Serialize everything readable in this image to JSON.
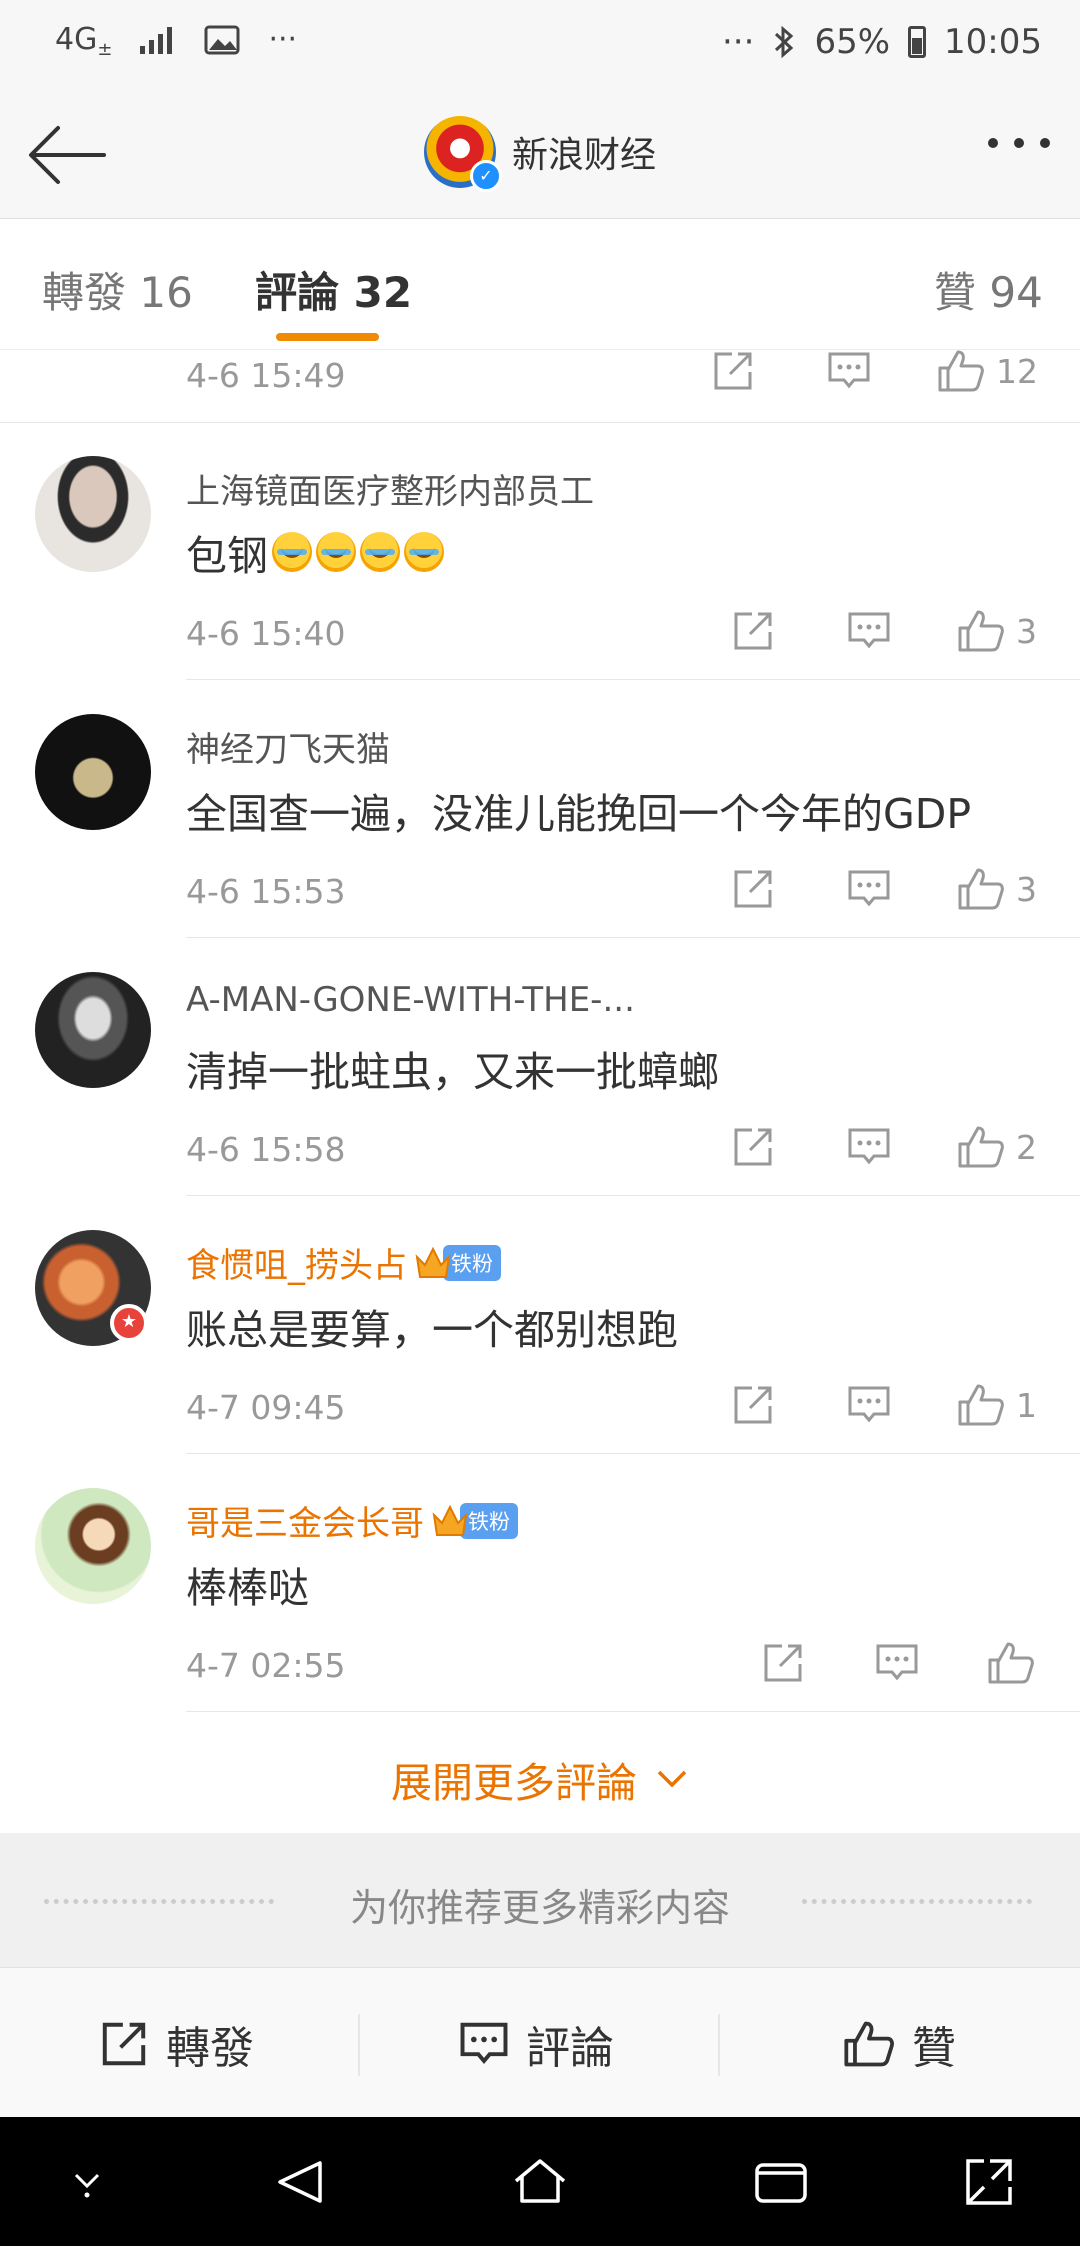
{
  "status_bar": {
    "network": "4G",
    "network_sub": "±",
    "overflow": "···",
    "right_overflow": "···",
    "battery": "65%",
    "time": "10:05"
  },
  "header": {
    "title": "新浪财经"
  },
  "tabs": [
    {
      "label": "轉發 16"
    },
    {
      "label": "評論 32"
    },
    {
      "label": "贊 94"
    }
  ],
  "partial_comment": {
    "time": "4-6 15:49",
    "likes": "12"
  },
  "comments": [
    {
      "name": "上海镜面医疗整形内部员工",
      "text": "包钢",
      "time": "4-6 15:40",
      "likes": "3"
    },
    {
      "name": "神经刀飞天猫",
      "text": "全国查一遍，没准儿能挽回一个今年的GDP",
      "time": "4-6 15:53",
      "likes": "3"
    },
    {
      "name": "A-MAN-GONE-WITH-THE-...",
      "text": "清掉一批蛀虫，又来一批蟑螂",
      "time": "4-6 15:58",
      "likes": "2"
    },
    {
      "name": "食惯咀_捞头占",
      "badge": "铁粉",
      "text": "账总是要算，一个都别想跑",
      "time": "4-7 09:45",
      "likes": "1"
    },
    {
      "name": "哥是三金会长哥",
      "badge": "铁粉",
      "text": "棒棒哒",
      "time": "4-7 02:55",
      "likes": ""
    }
  ],
  "expand_more": "展開更多評論",
  "recommend": "为你推荐更多精彩内容",
  "bottom_bar": {
    "repost": "轉發",
    "comment": "評論",
    "like": "贊"
  },
  "colors": {
    "accent": "#eb7300",
    "tab_indicator": "#f08a00",
    "fan_badge": "#5a9ff0"
  },
  "icons": [
    "back-arrow-icon",
    "more-icon",
    "repost-icon",
    "comment-icon",
    "like-icon",
    "chevron-down-icon",
    "nav-down-icon",
    "nav-back-icon",
    "nav-home-icon",
    "nav-recent-icon",
    "nav-expand-icon"
  ]
}
